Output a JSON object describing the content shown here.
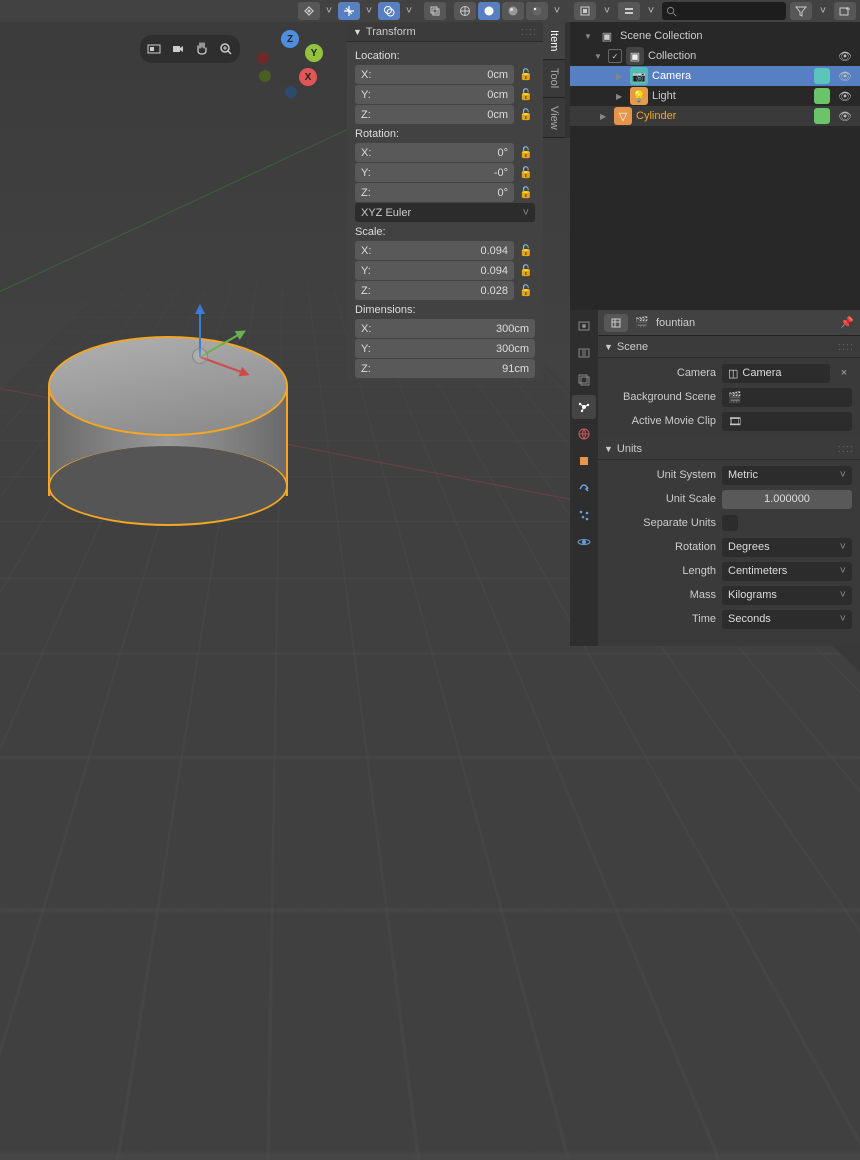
{
  "viewport": {
    "nav_axes": {
      "x": "X",
      "y": "Y",
      "z": "Z"
    }
  },
  "n_panel": {
    "title": "Transform",
    "tabs": [
      "Item",
      "Tool",
      "View"
    ],
    "location_label": "Location:",
    "rotation_label": "Rotation:",
    "scale_label": "Scale:",
    "dimensions_label": "Dimensions:",
    "location": {
      "x": "0cm",
      "y": "0cm",
      "z": "0cm"
    },
    "rotation": {
      "x": "0°",
      "y": "-0°",
      "z": "0°"
    },
    "rotation_mode": "XYZ Euler",
    "scale": {
      "x": "0.094",
      "y": "0.094",
      "z": "0.028"
    },
    "dimensions": {
      "x": "300cm",
      "y": "300cm",
      "z": "91cm"
    }
  },
  "outliner": {
    "search_placeholder": "",
    "root": "Scene Collection",
    "collection": "Collection",
    "items": [
      {
        "name": "Camera",
        "type": "camera"
      },
      {
        "name": "Light",
        "type": "light"
      },
      {
        "name": "Cylinder",
        "type": "mesh"
      }
    ]
  },
  "properties": {
    "breadcrumb": "fountian",
    "scene_panel": {
      "title": "Scene",
      "camera_label": "Camera",
      "camera_value": "Camera",
      "bg_label": "Background Scene",
      "bg_value": "",
      "clip_label": "Active Movie Clip",
      "clip_value": ""
    },
    "units_panel": {
      "title": "Units",
      "system_label": "Unit System",
      "system_value": "Metric",
      "scale_label": "Unit Scale",
      "scale_value": "1.000000",
      "separate_label": "Separate Units",
      "rotation_label": "Rotation",
      "rotation_value": "Degrees",
      "length_label": "Length",
      "length_value": "Centimeters",
      "mass_label": "Mass",
      "mass_value": "Kilograms",
      "time_label": "Time",
      "time_value": "Seconds"
    }
  }
}
